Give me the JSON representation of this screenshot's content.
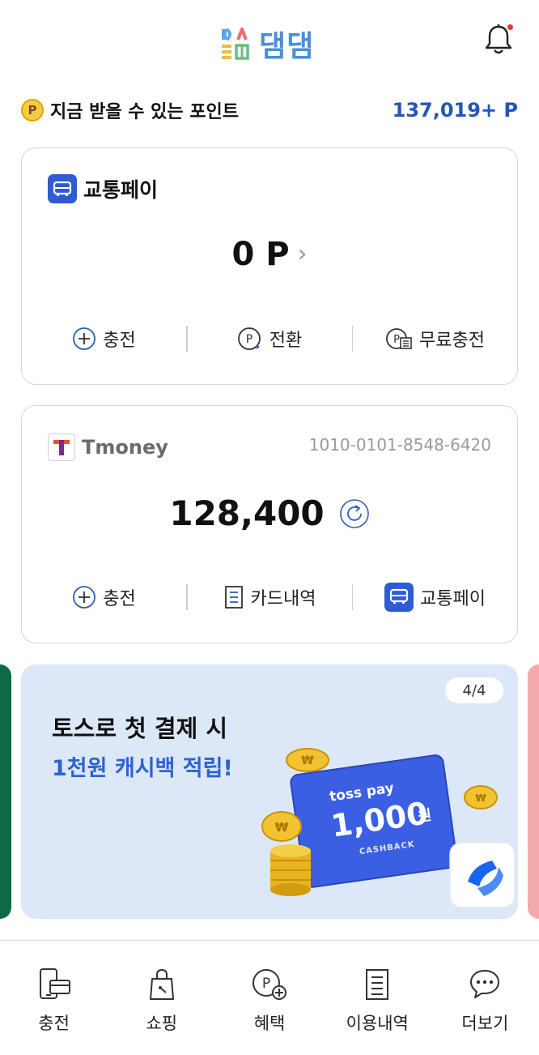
{
  "header": {
    "app_name": "댐댐"
  },
  "points": {
    "coin_letter": "P",
    "label": "지금 받을 수 있는 포인트",
    "value": "137,019+ P"
  },
  "transit_pay": {
    "title": "교통페이",
    "amount": "0 P",
    "chevron": "›",
    "actions": [
      {
        "label": "충전",
        "icon": "plus-circle-icon"
      },
      {
        "label": "전환",
        "icon": "point-convert-icon"
      },
      {
        "label": "무료충전",
        "icon": "point-card-icon"
      }
    ]
  },
  "tmoney": {
    "brand": "Tmoney",
    "card_number": "1010-0101-8548-6420",
    "balance": "128,400",
    "actions": [
      {
        "label": "충전",
        "icon": "plus-circle-icon"
      },
      {
        "label": "카드내역",
        "icon": "document-icon"
      },
      {
        "label": "교통페이",
        "icon": "bus-icon"
      }
    ]
  },
  "banner": {
    "page_indicator": "4/4",
    "line1": "토스로 첫 결제 시",
    "line2": "1천원 캐시백 적립!",
    "card_brand": "toss pay",
    "card_amount": "1,000",
    "card_unit": "원",
    "card_caption": "CASHBACK",
    "coin_symbol": "₩"
  },
  "tabbar": {
    "items": [
      {
        "label": "충전",
        "icon": "phone-card-icon"
      },
      {
        "label": "쇼핑",
        "icon": "shopping-bag-icon"
      },
      {
        "label": "혜택",
        "icon": "point-plus-icon"
      },
      {
        "label": "이용내역",
        "icon": "list-document-icon"
      },
      {
        "label": "더보기",
        "icon": "chat-more-icon"
      }
    ]
  },
  "colors": {
    "accent": "#2455b8",
    "bus_badge": "#2f5bd3",
    "banner_bg": "#dce8f7",
    "banner_highlight": "#2b63d1",
    "logo": "#4a8fd6",
    "notification_dot": "#e53935"
  }
}
